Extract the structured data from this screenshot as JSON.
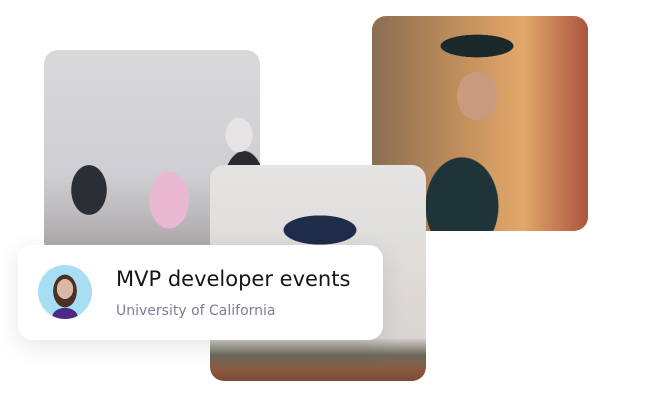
{
  "event_card": {
    "title": "MVP developer events",
    "subtitle": "University of California",
    "avatar": "student-avatar"
  },
  "photos": [
    "students-in-classroom-photo",
    "graduate-portrait-photo",
    "graduate-celebrating-photo"
  ]
}
